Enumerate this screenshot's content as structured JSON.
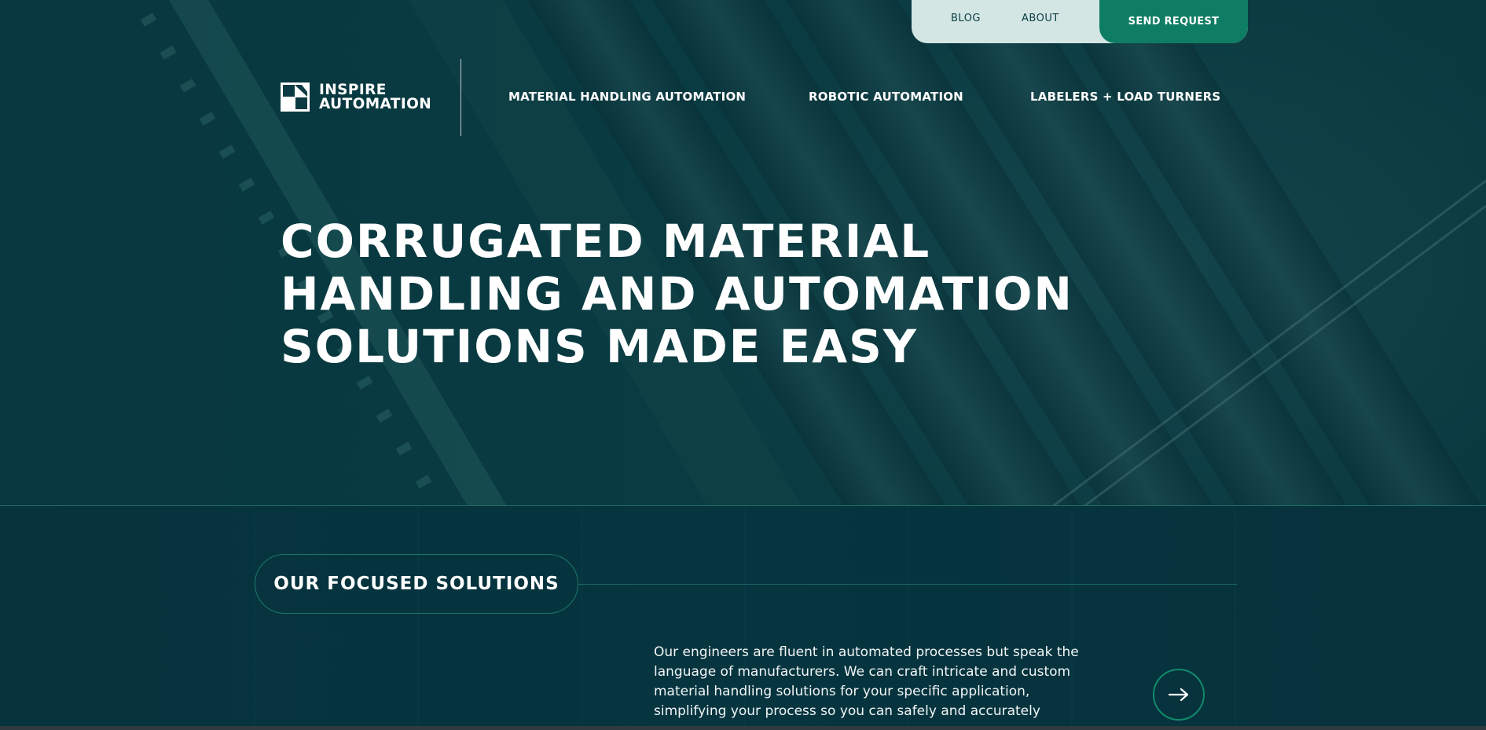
{
  "utility_nav": {
    "blog": "BLOG",
    "about": "ABOUT",
    "send_request": "SEND REQUEST"
  },
  "logo": {
    "line1": "INSPIRE",
    "line2": "AUTOMATION"
  },
  "main_nav": [
    {
      "label": "MATERIAL HANDLING AUTOMATION"
    },
    {
      "label": "ROBOTIC AUTOMATION"
    },
    {
      "label": "LABELERS + LOAD TURNERS"
    }
  ],
  "hero": {
    "headline_lines": [
      "CORRUGATED MATERIAL",
      "HANDLING AND AUTOMATION",
      "SOLUTIONS MADE EASY"
    ]
  },
  "solutions": {
    "pill_label": "OUR FOCUSED SOLUTIONS",
    "body_lines": [
      "Our engineers are fluent in automated processes but speak the",
      "language of manufacturers. We can craft intricate and custom",
      "material handling solutions for your specific application,",
      "simplifying your process so you can safely and accurately"
    ]
  },
  "colors": {
    "primary_green": "#0f7d63",
    "dark_teal": "#06333d",
    "light_mint": "#d3e6e3"
  },
  "icons": {
    "logo": "inspire-logo-mark",
    "next": "arrow-right-icon"
  }
}
